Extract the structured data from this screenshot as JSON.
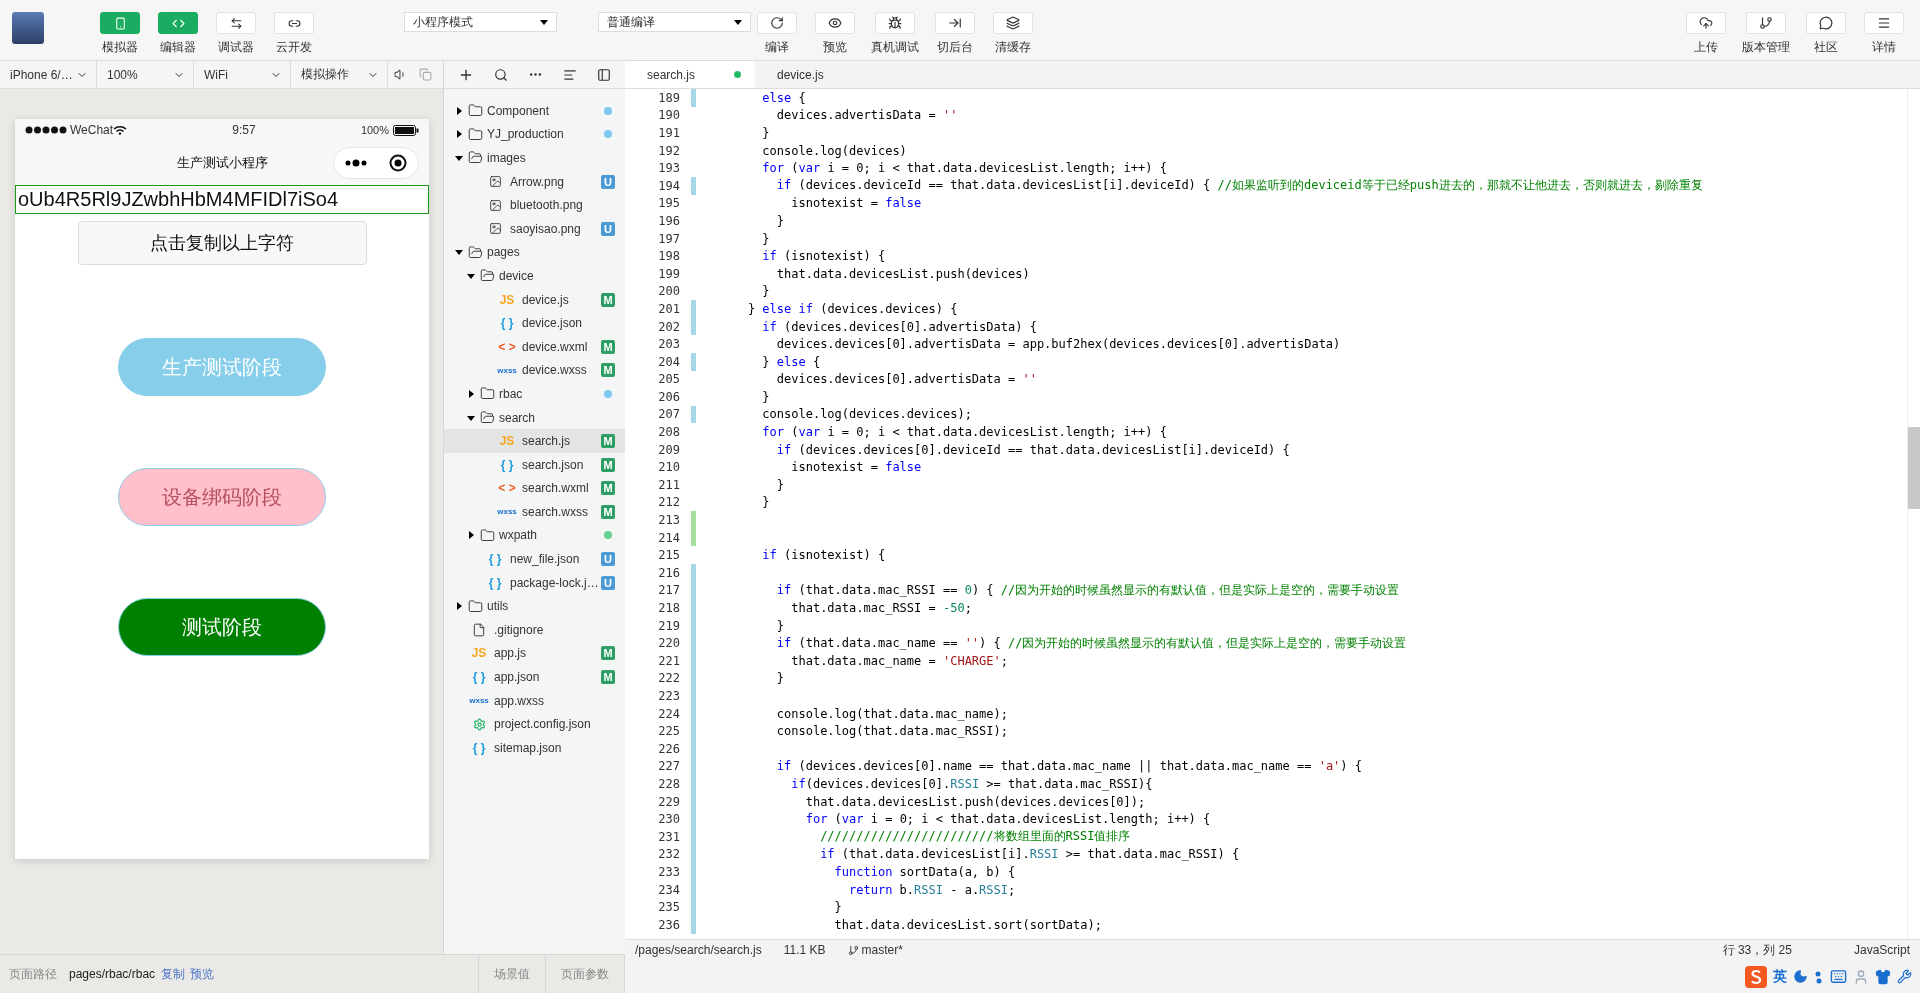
{
  "toolbar": {
    "modes": [
      {
        "label": "模拟器",
        "on": true
      },
      {
        "label": "编辑器",
        "on": true
      },
      {
        "label": "调试器",
        "on": false
      },
      {
        "label": "云开发",
        "on": false
      }
    ],
    "mode_select": "小程序模式",
    "compile_select": "普通编译",
    "actions": [
      {
        "label": "编译"
      },
      {
        "label": "预览"
      },
      {
        "label": "真机调试"
      },
      {
        "label": "切后台"
      },
      {
        "label": "清缓存"
      }
    ],
    "right": [
      {
        "label": "上传"
      },
      {
        "label": "版本管理"
      },
      {
        "label": "社区"
      },
      {
        "label": "详情"
      }
    ]
  },
  "simulator": {
    "controls": [
      "iPhone 6/…",
      "100%",
      "WiFi",
      "模拟操作"
    ],
    "phone": {
      "carrier": "WeChat",
      "time": "9:57",
      "battery": "100%",
      "title": "生产测试小程序",
      "input_value": "oUb4R5Rl9JZwbhHbM4MFIDl7iSo4",
      "copy_button": "点击复制以上字符",
      "buttons": [
        {
          "label": "生产测试阶段",
          "color": "#87ceeb"
        },
        {
          "label": "设备绑码阶段",
          "color": "#ffc0cb"
        },
        {
          "label": "测试阶段",
          "color": "#008000"
        }
      ]
    }
  },
  "files": [
    {
      "name": "Component",
      "kind": "folder",
      "expanded": false,
      "selected": false,
      "color": "#7cc6f0"
    },
    {
      "name": "YJ_production",
      "kind": "folder",
      "expanded": false,
      "selected": false,
      "color": "#7cc6f0"
    },
    {
      "name": "images",
      "kind": "folder",
      "expanded": true,
      "selected": false,
      "children": [
        {
          "name": "Arrow.png",
          "kind": "image",
          "selected": false,
          "badge": {
            "text": "U",
            "color": "#4b9ad3"
          }
        },
        {
          "name": "bluetooth.png",
          "kind": "image",
          "selected": false
        },
        {
          "name": "saoyisao.png",
          "kind": "image",
          "selected": false,
          "badge": {
            "text": "U",
            "color": "#4b9ad3"
          }
        }
      ]
    },
    {
      "name": "pages",
      "kind": "folder",
      "expanded": true,
      "selected": false,
      "children": [
        {
          "name": "device",
          "kind": "folder",
          "expanded": true,
          "selected": false,
          "children": [
            {
              "name": "device.js",
              "kind": "js",
              "icon": "JS",
              "selected": false,
              "badge": {
                "text": "M",
                "color": "#2f9e64"
              }
            },
            {
              "name": "device.json",
              "kind": "json",
              "icon": "{ }",
              "selected": false
            },
            {
              "name": "device.wxml",
              "kind": "wxml",
              "icon": "< >",
              "selected": false,
              "badge": {
                "text": "M",
                "color": "#2f9e64"
              }
            },
            {
              "name": "device.wxss",
              "kind": "wxss",
              "icon": "wxss",
              "selected": false,
              "badge": {
                "text": "M",
                "color": "#2f9e64"
              }
            }
          ]
        },
        {
          "name": "rbac",
          "kind": "folder",
          "expanded": false,
          "selected": false,
          "color": "#7cc6f0"
        },
        {
          "name": "search",
          "kind": "folder",
          "expanded": true,
          "selected": false,
          "children": [
            {
              "name": "search.js",
              "kind": "js",
              "icon": "JS",
              "selected": true,
              "badge": {
                "text": "M",
                "color": "#2f9e64"
              }
            },
            {
              "name": "search.json",
              "kind": "json",
              "icon": "{ }",
              "selected": false,
              "badge": {
                "text": "M",
                "color": "#2f9e64"
              }
            },
            {
              "name": "search.wxml",
              "kind": "wxml",
              "icon": "< >",
              "selected": false,
              "badge": {
                "text": "M",
                "color": "#2f9e64"
              }
            },
            {
              "name": "search.wxss",
              "kind": "wxss",
              "icon": "wxss",
              "selected": false,
              "badge": {
                "text": "M",
                "color": "#2f9e64"
              }
            }
          ]
        },
        {
          "name": "wxpath",
          "kind": "folder",
          "expanded": false,
          "selected": false,
          "color": "#5fd38f"
        },
        {
          "name": "new_file.json",
          "kind": "json",
          "icon": "{ }",
          "selected": false,
          "badge": {
            "text": "U",
            "color": "#4b9ad3"
          }
        },
        {
          "name": "package-lock.j…",
          "kind": "json",
          "icon": "{ }",
          "selected": false,
          "badge": {
            "text": "U",
            "color": "#4b9ad3"
          }
        }
      ]
    },
    {
      "name": "utils",
      "kind": "folder",
      "expanded": false,
      "selected": false
    },
    {
      "name": ".gitignore",
      "kind": "file",
      "selected": false
    },
    {
      "name": "app.js",
      "kind": "js",
      "icon": "JS",
      "selected": false,
      "badge": {
        "text": "M",
        "color": "#2f9e64"
      }
    },
    {
      "name": "app.json",
      "kind": "json",
      "icon": "{ }",
      "selected": false,
      "badge": {
        "text": "M",
        "color": "#2f9e64"
      }
    },
    {
      "name": "app.wxss",
      "kind": "wxss",
      "icon": "wxss",
      "selected": false
    },
    {
      "name": "project.config.json",
      "kind": "config",
      "selected": false
    },
    {
      "name": "sitemap.json",
      "kind": "json",
      "icon": "{ }",
      "selected": false
    }
  ],
  "editor": {
    "tabs": [
      {
        "label": "search.js",
        "selected": true,
        "unsaved": true
      },
      {
        "label": "device.js",
        "selected": false,
        "unsaved": false
      }
    ],
    "lines": [
      {
        "n": "189",
        "modified": true,
        "added": false,
        "parts": [
          {
            "kind": "keyword",
            "t": "      else"
          },
          {
            "kind": "plain",
            "t": " {"
          }
        ]
      },
      {
        "n": "190",
        "modified": false,
        "added": false,
        "parts": [
          {
            "kind": "plain",
            "t": "        devices.advertisData = "
          },
          {
            "kind": "string",
            "t": "''"
          }
        ]
      },
      {
        "n": "191",
        "modified": false,
        "added": false,
        "parts": [
          {
            "kind": "plain",
            "t": "      }"
          }
        ]
      },
      {
        "n": "192",
        "modified": false,
        "added": false,
        "parts": [
          {
            "kind": "plain",
            "t": "      console.log(devices)"
          }
        ]
      },
      {
        "n": "193",
        "modified": false,
        "added": false,
        "parts": [
          {
            "kind": "keyword",
            "t": "      for"
          },
          {
            "kind": "plain",
            "t": " ("
          },
          {
            "kind": "keyword",
            "t": "var"
          },
          {
            "kind": "plain",
            "t": " i = 0; i < that.data.devicesList.length; i++) {"
          }
        ]
      },
      {
        "n": "194",
        "modified": true,
        "added": false,
        "parts": [
          {
            "kind": "keyword",
            "t": "        if"
          },
          {
            "kind": "plain",
            "t": " (devices.deviceId == that.data.devicesList[i].deviceId) { "
          },
          {
            "kind": "comment",
            "t": "//如果监听到的deviceid等于已经push进去的，那就不让他进去，否则就进去，剔除重复"
          }
        ]
      },
      {
        "n": "195",
        "modified": false,
        "added": false,
        "parts": [
          {
            "kind": "plain",
            "t": "          isnotexist = "
          },
          {
            "kind": "keyword",
            "t": "false"
          }
        ]
      },
      {
        "n": "196",
        "modified": false,
        "added": false,
        "parts": [
          {
            "kind": "plain",
            "t": "        }"
          }
        ]
      },
      {
        "n": "197",
        "modified": false,
        "added": false,
        "parts": [
          {
            "kind": "plain",
            "t": "      }"
          }
        ]
      },
      {
        "n": "198",
        "modified": false,
        "added": false,
        "parts": [
          {
            "kind": "keyword",
            "t": "      if"
          },
          {
            "kind": "plain",
            "t": " (isnotexist) {"
          }
        ]
      },
      {
        "n": "199",
        "modified": false,
        "added": false,
        "parts": [
          {
            "kind": "plain",
            "t": "        that.data.devicesList.push(devices)"
          }
        ]
      },
      {
        "n": "200",
        "modified": false,
        "added": false,
        "parts": [
          {
            "kind": "plain",
            "t": "      }"
          }
        ]
      },
      {
        "n": "201",
        "modified": true,
        "added": false,
        "parts": [
          {
            "kind": "plain",
            "t": "    } "
          },
          {
            "kind": "keyword",
            "t": "else if"
          },
          {
            "kind": "plain",
            "t": " (devices.devices) {"
          }
        ]
      },
      {
        "n": "202",
        "modified": true,
        "added": false,
        "parts": [
          {
            "kind": "keyword",
            "t": "      if"
          },
          {
            "kind": "plain",
            "t": " (devices.devices[0].advertisData) {"
          }
        ]
      },
      {
        "n": "203",
        "modified": false,
        "added": false,
        "parts": [
          {
            "kind": "plain",
            "t": "        devices.devices[0].advertisData = app.buf2hex(devices.devices[0].advertisData)"
          }
        ]
      },
      {
        "n": "204",
        "modified": true,
        "added": false,
        "parts": [
          {
            "kind": "plain",
            "t": "      } "
          },
          {
            "kind": "keyword",
            "t": "else"
          },
          {
            "kind": "plain",
            "t": " {"
          }
        ]
      },
      {
        "n": "205",
        "modified": false,
        "added": false,
        "parts": [
          {
            "kind": "plain",
            "t": "        devices.devices[0].advertisData = "
          },
          {
            "kind": "string",
            "t": "''"
          }
        ]
      },
      {
        "n": "206",
        "modified": false,
        "added": false,
        "parts": [
          {
            "kind": "plain",
            "t": "      }"
          }
        ]
      },
      {
        "n": "207",
        "modified": true,
        "added": false,
        "parts": [
          {
            "kind": "plain",
            "t": "      console.log(devices.devices);"
          }
        ]
      },
      {
        "n": "208",
        "modified": false,
        "added": false,
        "parts": [
          {
            "kind": "keyword",
            "t": "      for"
          },
          {
            "kind": "plain",
            "t": " ("
          },
          {
            "kind": "keyword",
            "t": "var"
          },
          {
            "kind": "plain",
            "t": " i = 0; i < that.data.devicesList.length; i++) {"
          }
        ]
      },
      {
        "n": "209",
        "modified": false,
        "added": false,
        "parts": [
          {
            "kind": "keyword",
            "t": "        if"
          },
          {
            "kind": "plain",
            "t": " (devices.devices[0].deviceId == that.data.devicesList[i].deviceId) {"
          }
        ]
      },
      {
        "n": "210",
        "modified": false,
        "added": false,
        "parts": [
          {
            "kind": "plain",
            "t": "          isnotexist = "
          },
          {
            "kind": "keyword",
            "t": "false"
          }
        ]
      },
      {
        "n": "211",
        "modified": false,
        "added": false,
        "parts": [
          {
            "kind": "plain",
            "t": "        }"
          }
        ]
      },
      {
        "n": "212",
        "modified": false,
        "added": false,
        "parts": [
          {
            "kind": "plain",
            "t": "      }"
          }
        ]
      },
      {
        "n": "213",
        "modified": false,
        "added": true
      },
      {
        "n": "214",
        "modified": false,
        "added": true
      },
      {
        "n": "215",
        "modified": false,
        "added": false,
        "parts": [
          {
            "kind": "keyword",
            "t": "      if"
          },
          {
            "kind": "plain",
            "t": " (isnotexist) {"
          }
        ]
      },
      {
        "n": "216",
        "modified": true,
        "added": false
      },
      {
        "n": "217",
        "modified": true,
        "added": false,
        "parts": [
          {
            "kind": "keyword",
            "t": "        if"
          },
          {
            "kind": "plain",
            "t": " (that.data.mac_RSSI == "
          },
          {
            "kind": "number",
            "t": "0"
          },
          {
            "kind": "plain",
            "t": ") { "
          },
          {
            "kind": "comment",
            "t": "//因为开始的时候虽然显示的有默认值，但是实际上是空的，需要手动设置"
          }
        ]
      },
      {
        "n": "218",
        "modified": true,
        "added": false,
        "parts": [
          {
            "kind": "plain",
            "t": "          that.data.mac_RSSI = "
          },
          {
            "kind": "number",
            "t": "-50"
          },
          {
            "kind": "plain",
            "t": ";"
          }
        ]
      },
      {
        "n": "219",
        "modified": true,
        "added": false,
        "parts": [
          {
            "kind": "plain",
            "t": "        }"
          }
        ]
      },
      {
        "n": "220",
        "modified": true,
        "added": false,
        "parts": [
          {
            "kind": "keyword",
            "t": "        if"
          },
          {
            "kind": "plain",
            "t": " (that.data.mac_name == "
          },
          {
            "kind": "string",
            "t": "''"
          },
          {
            "kind": "plain",
            "t": ") { "
          },
          {
            "kind": "comment",
            "t": "//因为开始的时候虽然显示的有默认值，但是实际上是空的，需要手动设置"
          }
        ]
      },
      {
        "n": "221",
        "modified": true,
        "added": false,
        "parts": [
          {
            "kind": "plain",
            "t": "          that.data.mac_name = "
          },
          {
            "kind": "string",
            "t": "'CHARGE'"
          },
          {
            "kind": "plain",
            "t": ";"
          }
        ]
      },
      {
        "n": "222",
        "modified": true,
        "added": false,
        "parts": [
          {
            "kind": "plain",
            "t": "        }"
          }
        ]
      },
      {
        "n": "223",
        "modified": true,
        "added": false
      },
      {
        "n": "224",
        "modified": true,
        "added": false,
        "parts": [
          {
            "kind": "plain",
            "t": "        console.log(that.data.mac_name);"
          }
        ]
      },
      {
        "n": "225",
        "modified": true,
        "added": false,
        "parts": [
          {
            "kind": "plain",
            "t": "        console.log(that.data.mac_RSSI);"
          }
        ]
      },
      {
        "n": "226",
        "modified": true,
        "added": false
      },
      {
        "n": "227",
        "modified": true,
        "added": false,
        "parts": [
          {
            "kind": "keyword",
            "t": "        if"
          },
          {
            "kind": "plain",
            "t": " (devices.devices[0].name == that.data.mac_name || that.data.mac_name == "
          },
          {
            "kind": "string",
            "t": "'a'"
          },
          {
            "kind": "plain",
            "t": ") {"
          }
        ]
      },
      {
        "n": "228",
        "modified": true,
        "added": false,
        "parts": [
          {
            "kind": "keyword",
            "t": "          if"
          },
          {
            "kind": "plain",
            "t": "(devices.devices[0]."
          },
          {
            "kind": "field",
            "t": "RSSI"
          },
          {
            "kind": "plain",
            "t": " >= that.data.mac_RSSI){"
          }
        ]
      },
      {
        "n": "229",
        "modified": true,
        "added": false,
        "parts": [
          {
            "kind": "plain",
            "t": "            that.data.devicesList.push(devices.devices[0]);"
          }
        ]
      },
      {
        "n": "230",
        "modified": true,
        "added": false,
        "parts": [
          {
            "kind": "keyword",
            "t": "            for"
          },
          {
            "kind": "plain",
            "t": " ("
          },
          {
            "kind": "keyword",
            "t": "var"
          },
          {
            "kind": "plain",
            "t": " i = 0; i < that.data.devicesList.length; i++) {"
          }
        ]
      },
      {
        "n": "231",
        "modified": true,
        "added": false,
        "parts": [
          {
            "kind": "comment",
            "t": "              ////////////////////////将数组里面的RSSI值排序"
          }
        ]
      },
      {
        "n": "232",
        "modified": true,
        "added": false,
        "parts": [
          {
            "kind": "keyword",
            "t": "              if"
          },
          {
            "kind": "plain",
            "t": " (that.data.devicesList[i]."
          },
          {
            "kind": "field",
            "t": "RSSI"
          },
          {
            "kind": "plain",
            "t": " >= that.data.mac_RSSI) {"
          }
        ]
      },
      {
        "n": "233",
        "modified": true,
        "added": false,
        "parts": [
          {
            "kind": "keyword",
            "t": "                function"
          },
          {
            "kind": "plain",
            "t": " sortData(a, b) {"
          }
        ]
      },
      {
        "n": "234",
        "modified": true,
        "added": false,
        "parts": [
          {
            "kind": "keyword",
            "t": "                  return"
          },
          {
            "kind": "plain",
            "t": " b."
          },
          {
            "kind": "field",
            "t": "RSSI"
          },
          {
            "kind": "plain",
            "t": " - a."
          },
          {
            "kind": "field",
            "t": "RSSI"
          },
          {
            "kind": "plain",
            "t": ";"
          }
        ]
      },
      {
        "n": "235",
        "modified": true,
        "added": false,
        "parts": [
          {
            "kind": "plain",
            "t": "                }"
          }
        ]
      },
      {
        "n": "236",
        "modified": true,
        "added": false,
        "parts": [
          {
            "kind": "plain",
            "t": "                that.data.devicesList.sort(sortData);"
          }
        ]
      }
    ],
    "status": {
      "path": "/pages/search/search.js",
      "size": "11.1 KB",
      "branch": "master*",
      "position": "行 33，列 25",
      "language": "JavaScript"
    }
  },
  "bottom_bar": {
    "label": "页面路径",
    "path": "pages/rbac/rbac",
    "links": [
      "复制",
      "预览"
    ],
    "scene": "场景值",
    "params": "页面参数"
  },
  "ime": {
    "label": "英"
  }
}
